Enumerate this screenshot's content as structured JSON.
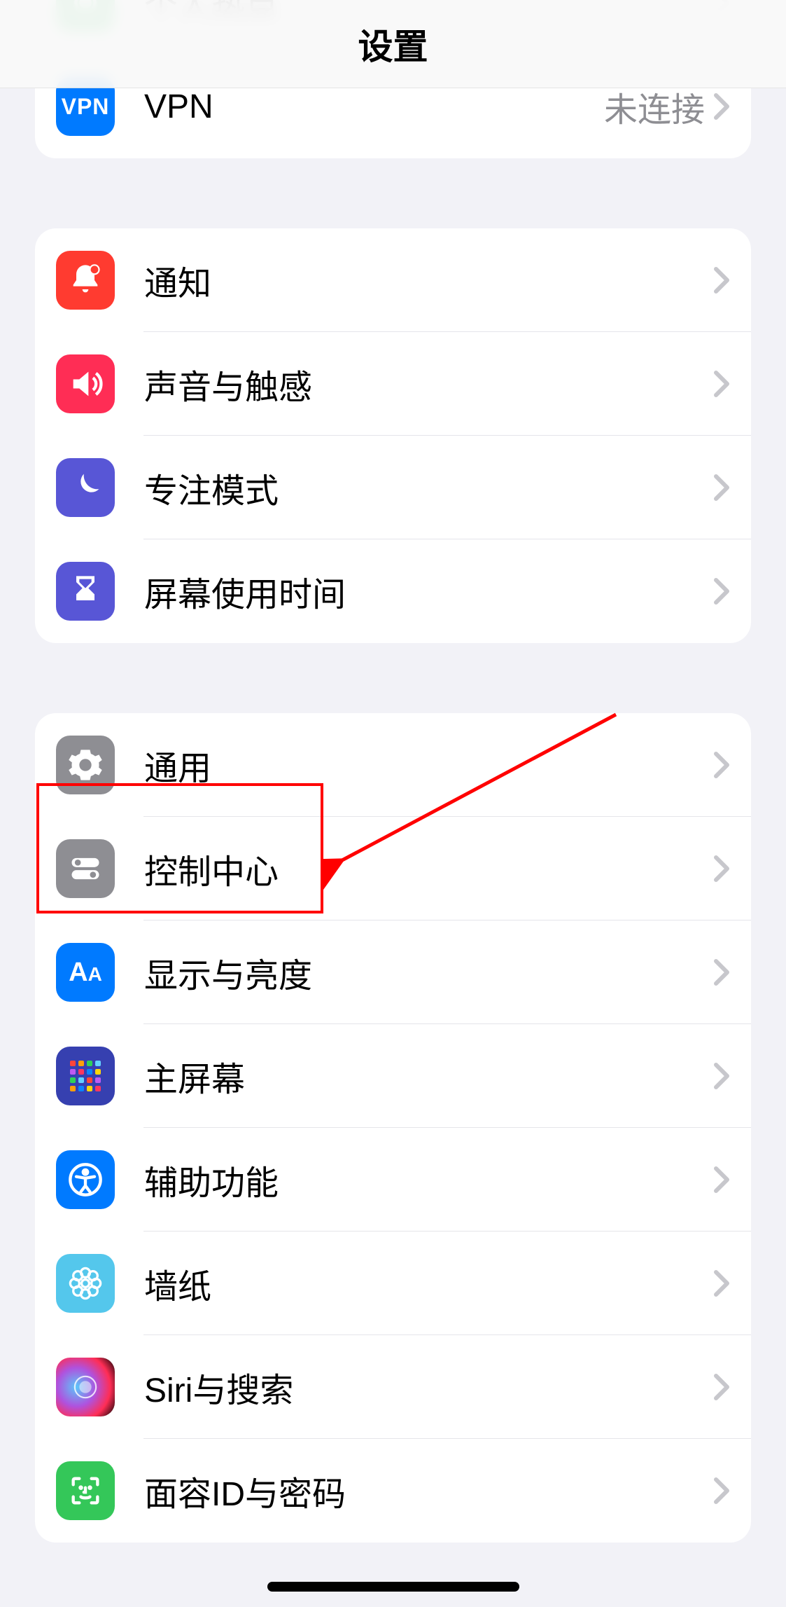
{
  "header": {
    "title": "设置"
  },
  "group1": {
    "items": [
      {
        "name": "hotspot",
        "label": "个人热点",
        "value": "",
        "color": "#34c759"
      },
      {
        "name": "vpn",
        "label": "VPN",
        "value": "未连接",
        "color": "#007aff"
      }
    ]
  },
  "group2": {
    "items": [
      {
        "name": "notifications",
        "label": "通知",
        "color": "#ff3b30"
      },
      {
        "name": "sounds",
        "label": "声音与触感",
        "color": "#ff2d55"
      },
      {
        "name": "focus",
        "label": "专注模式",
        "color": "#5856d6"
      },
      {
        "name": "screentime",
        "label": "屏幕使用时间",
        "color": "#5856d6"
      }
    ]
  },
  "group3": {
    "items": [
      {
        "name": "general",
        "label": "通用",
        "color": "#8e8e93"
      },
      {
        "name": "control-center",
        "label": "控制中心",
        "color": "#8e8e93"
      },
      {
        "name": "display",
        "label": "显示与亮度",
        "color": "#007aff"
      },
      {
        "name": "home-screen",
        "label": "主屏幕",
        "color": "#3a3a8f"
      },
      {
        "name": "accessibility",
        "label": "辅助功能",
        "color": "#007aff"
      },
      {
        "name": "wallpaper",
        "label": "墙纸",
        "color": "#54c7ec"
      },
      {
        "name": "siri",
        "label": "Siri与搜索",
        "color": "#000"
      },
      {
        "name": "faceid",
        "label": "面容ID与密码",
        "color": "#34c759"
      }
    ]
  },
  "annotation": {
    "target": "general"
  }
}
